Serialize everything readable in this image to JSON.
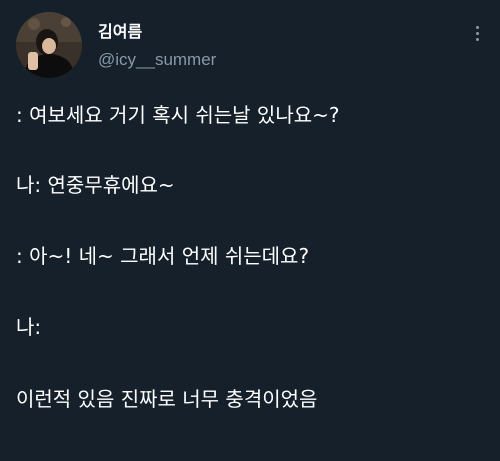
{
  "author": {
    "display_name": "김여름",
    "handle": "@icy__summer"
  },
  "tweet": {
    "lines": [
      ": 여보세요 거기 혹시 쉬는날 있나요~?",
      "나: 연중무휴에요~",
      ": 아~! 네~ 그래서 언제 쉬는데요?",
      "나:",
      "이런적 있음 진짜로 너무 충격이었음"
    ]
  },
  "icons": {
    "more": "more-options-icon"
  },
  "colors": {
    "background": "#15202b",
    "text_primary": "#ffffff",
    "text_secondary": "#8899a6"
  }
}
